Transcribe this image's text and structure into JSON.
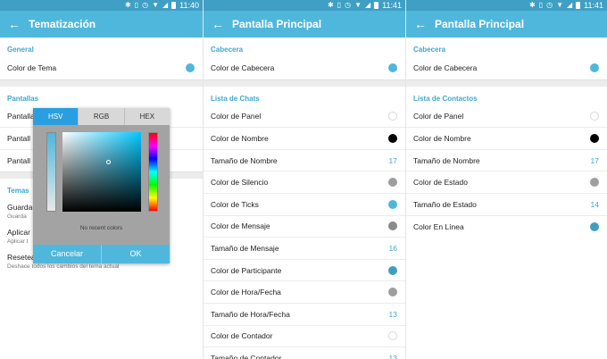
{
  "colors": {
    "accent": "#4fb7db",
    "section": "#3fa7ce",
    "black": "#000000",
    "gray": "#9e9e9e",
    "white": "#ffffff"
  },
  "screens": [
    {
      "time": "11:40",
      "title": "Tematización",
      "general_header": "General",
      "color_tema_label": "Color de Tema",
      "pantallas_header": "Pantallas",
      "pantallas_rows": [
        "Pantalla",
        "Pantall",
        "Pantall"
      ],
      "temas_header": "Temas",
      "guardar_label": "Guardar",
      "guardar_sub": "Guarda",
      "aplicar_label": "Aplicar",
      "aplicar_sub": "Aplicar t",
      "resetear_label": "Resetea",
      "resetear_sub": "Deshace todos los cambios del tema actual",
      "dialog": {
        "tabs": [
          "HSV",
          "RGB",
          "HEX"
        ],
        "no_recent": "No recent colors",
        "cancel": "Cancelar",
        "ok": "OK"
      }
    },
    {
      "time": "11:41",
      "title": "Pantalla Principal",
      "header1": "Cabecera",
      "cabecera_label": "Color de Cabecera",
      "header2": "Lista de Chats",
      "rows": [
        {
          "label": "Color de Panel",
          "type": "dot",
          "color": "#ffffff"
        },
        {
          "label": "Color de Nombre",
          "type": "dot",
          "color": "#000000"
        },
        {
          "label": "Tamaño de Nombre",
          "type": "num",
          "value": "17"
        },
        {
          "label": "Color de Silencio",
          "type": "dot",
          "color": "#9e9e9e"
        },
        {
          "label": "Color de Ticks",
          "type": "dot",
          "color": "#4fb7db"
        },
        {
          "label": "Color de Mensaje",
          "type": "dot",
          "color": "#8a8a8a"
        },
        {
          "label": "Tamaño de Mensaje",
          "type": "num",
          "value": "16"
        },
        {
          "label": "Color de Participante",
          "type": "dot",
          "color": "#3e9fc2"
        },
        {
          "label": "Color de Hora/Fecha",
          "type": "dot",
          "color": "#9e9e9e"
        },
        {
          "label": "Tamaño de Hora/Fecha",
          "type": "num",
          "value": "13"
        },
        {
          "label": "Color de Contador",
          "type": "dot",
          "color": "#ffffff"
        },
        {
          "label": "Tamaño de Contador",
          "type": "num",
          "value": "13"
        }
      ]
    },
    {
      "time": "11:41",
      "title": "Pantalla Principal",
      "header1": "Cabecera",
      "cabecera_label": "Color de Cabecera",
      "header2": "Lista de Contactos",
      "rows": [
        {
          "label": "Color de Panel",
          "type": "dot",
          "color": "#ffffff"
        },
        {
          "label": "Color de Nombre",
          "type": "dot",
          "color": "#000000"
        },
        {
          "label": "Tamaño de Nombre",
          "type": "num",
          "value": "17"
        },
        {
          "label": "Color de Estado",
          "type": "dot",
          "color": "#9e9e9e"
        },
        {
          "label": "Tamaño de Estado",
          "type": "num",
          "value": "14"
        },
        {
          "label": "Color En Línea",
          "type": "dot",
          "color": "#3e9fc2"
        }
      ]
    }
  ]
}
